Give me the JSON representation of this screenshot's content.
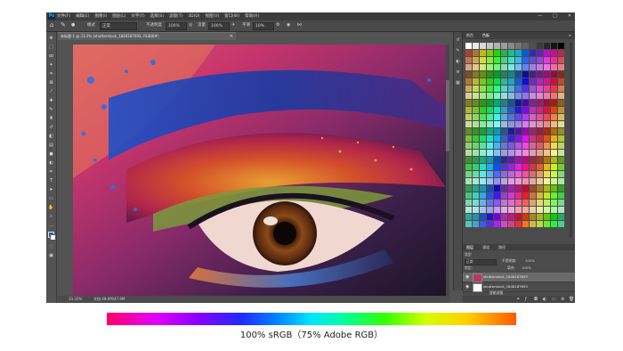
{
  "menubar": {
    "logo": "Ps",
    "items": [
      "文件(F)",
      "编辑(E)",
      "图像(I)",
      "图层(L)",
      "文字(Y)",
      "选择(S)",
      "滤镜(T)",
      "3D(D)",
      "视图(V)",
      "窗口(W)",
      "帮助(H)"
    ],
    "window_controls": [
      "—",
      "□",
      "✕"
    ]
  },
  "options_bar": {
    "mode_label": "模式",
    "mode_value": "正常",
    "opacity_label": "不透明度",
    "opacity_value": "100%",
    "flow_label": "流量",
    "flow_value": "100%",
    "smooth_label": "平滑",
    "smooth_value": "10%"
  },
  "document": {
    "tab_label": "未标题-1 @ 33.3% (shutterstock_1848187693, RGB/8#)",
    "close": "✕"
  },
  "status": {
    "zoom": "33.33%",
    "doc_info": "文档:48.0M/47.9M"
  },
  "right_panel": {
    "tabs": [
      "颜色",
      "色板"
    ],
    "active_tab": "色板"
  },
  "layers": {
    "tabs": [
      "图层",
      "通道",
      "路径"
    ],
    "active_tab": "图层",
    "kind_label": "类型",
    "blend_mode": "正常",
    "opacity_label": "不透明度:",
    "opacity_value": "100%",
    "lock_label": "锁定:",
    "fill_label": "填充:",
    "fill_value": "100%",
    "rows": [
      {
        "name": "shutterstock_1848187693",
        "selected": true
      },
      {
        "name": "shutterstock_1848187693",
        "selected": false
      }
    ],
    "sub_label": "智能滤镜",
    "sub_item": "高斯模糊"
  },
  "caption": {
    "text": "100% sRGB（75% Adobe RGB）"
  },
  "colors": {
    "app_bg": "#535353",
    "menubar": "#3c3c3c",
    "panel": "#4b4b4b",
    "accent": "#31a8ff"
  },
  "icons": {
    "tools": [
      "move-icon",
      "marquee-icon",
      "lasso-icon",
      "quick-select-icon",
      "crop-icon",
      "frame-icon",
      "eyedropper-icon",
      "healing-icon",
      "brush-icon",
      "stamp-icon",
      "history-brush-icon",
      "eraser-icon",
      "gradient-icon",
      "blur-icon",
      "dodge-icon",
      "pen-icon",
      "type-icon",
      "path-select-icon",
      "shape-icon",
      "hand-icon",
      "zoom-icon",
      "more-icon"
    ]
  }
}
